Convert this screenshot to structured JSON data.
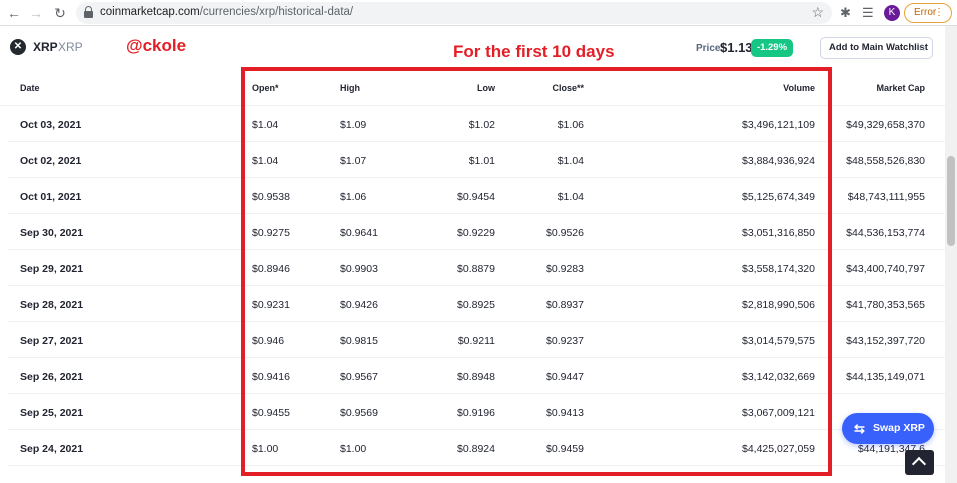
{
  "browser": {
    "url_host": "coinmarketcap.com",
    "url_path": "/currencies/xrp/historical-data/",
    "profile_initial": "K",
    "error_label": "Error"
  },
  "header": {
    "coin_name": "XRP",
    "coin_symbol": "XRP",
    "watermark": "@ckole",
    "annotation": "For the first 10 days",
    "price_label": "Price:",
    "price_value": "$1.13",
    "price_change": "-1.29%",
    "watchlist_label": "Add to Main Watchlist",
    "accent_color": "#16c784",
    "annotation_color": "#e41e26"
  },
  "table": {
    "columns": [
      "Date",
      "Open*",
      "High",
      "Low",
      "Close**",
      "Volume",
      "Market Cap"
    ],
    "rows": [
      [
        "Oct 03, 2021",
        "$1.04",
        "$1.09",
        "$1.02",
        "$1.06",
        "$3,496,121,109",
        "$49,329,658,370"
      ],
      [
        "Oct 02, 2021",
        "$1.04",
        "$1.07",
        "$1.01",
        "$1.04",
        "$3,884,936,924",
        "$48,558,526,830"
      ],
      [
        "Oct 01, 2021",
        "$0.9538",
        "$1.06",
        "$0.9454",
        "$1.04",
        "$5,125,674,349",
        "$48,743,111,955"
      ],
      [
        "Sep 30, 2021",
        "$0.9275",
        "$0.9641",
        "$0.9229",
        "$0.9526",
        "$3,051,316,850",
        "$44,536,153,774"
      ],
      [
        "Sep 29, 2021",
        "$0.8946",
        "$0.9903",
        "$0.8879",
        "$0.9283",
        "$3,558,174,320",
        "$43,400,740,797"
      ],
      [
        "Sep 28, 2021",
        "$0.9231",
        "$0.9426",
        "$0.8925",
        "$0.8937",
        "$2,818,990,506",
        "$41,780,353,565"
      ],
      [
        "Sep 27, 2021",
        "$0.946",
        "$0.9815",
        "$0.9211",
        "$0.9237",
        "$3,014,579,575",
        "$43,152,397,720"
      ],
      [
        "Sep 26, 2021",
        "$0.9416",
        "$0.9567",
        "$0.8948",
        "$0.9447",
        "$3,142,032,669",
        "$44,135,149,071"
      ],
      [
        "Sep 25, 2021",
        "$0.9455",
        "$0.9569",
        "$0.9196",
        "$0.9413",
        "$3,067,009,121",
        ""
      ],
      [
        "Sep 24, 2021",
        "$1.00",
        "$1.00",
        "$0.8924",
        "$0.9459",
        "$4,425,027,059",
        "$44,191,347,6"
      ]
    ]
  },
  "floating": {
    "swap_label": "Swap XRP"
  }
}
